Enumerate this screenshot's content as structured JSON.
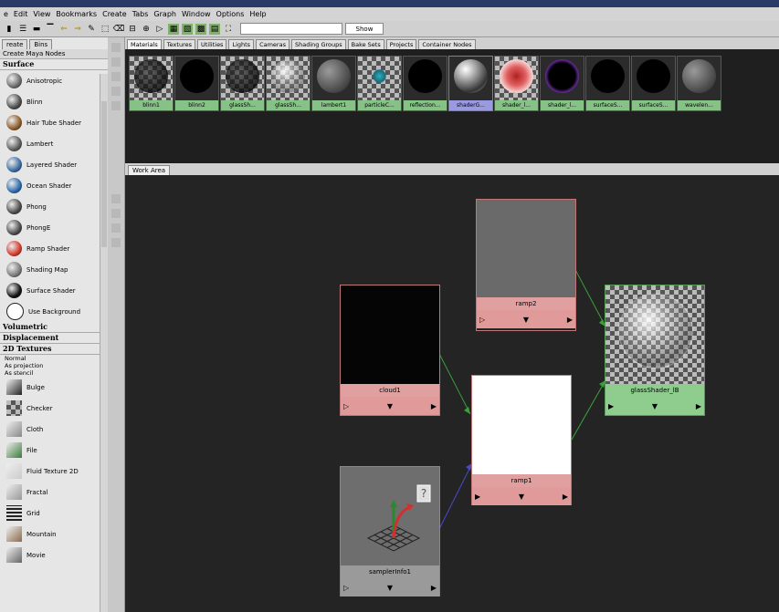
{
  "menubar": {
    "items": [
      "e",
      "Edit",
      "View",
      "Bookmarks",
      "Create",
      "Tabs",
      "Graph",
      "Window",
      "Options",
      "Help"
    ]
  },
  "toolbar": {
    "show_label": "Show",
    "search_value": ""
  },
  "left_panel": {
    "tabs": [
      "reate",
      "Bins"
    ],
    "create_label": "Create Maya Nodes",
    "categories": {
      "surface": "Surface",
      "volumetric": "Volumetric",
      "displacement": "Displacement",
      "textures_2d": "2D Textures"
    },
    "surface_items": [
      {
        "label": "Anisotropic",
        "color": "#6a6a6a"
      },
      {
        "label": "Blinn",
        "color": "#4a4a4a"
      },
      {
        "label": "Hair Tube Shader",
        "color": "#8a5a2a"
      },
      {
        "label": "Lambert",
        "color": "#5a5a5a"
      },
      {
        "label": "Layered Shader",
        "color": "#3a6aa0"
      },
      {
        "label": "Ocean Shader",
        "color": "#2a6aaa"
      },
      {
        "label": "Phong",
        "color": "#4a4a4a"
      },
      {
        "label": "PhongE",
        "color": "#4a4a4a"
      },
      {
        "label": "Ramp Shader",
        "color": "#d03a2a"
      },
      {
        "label": "Shading Map",
        "color": "#7a7a7a"
      },
      {
        "label": "Surface Shader",
        "color": "#111111"
      },
      {
        "label": "Use Background",
        "color": "#ffffff"
      }
    ],
    "texture_options": [
      "Normal",
      "As projection",
      "As stencil"
    ],
    "texture_items": [
      {
        "label": "Bulge",
        "color": "#222222"
      },
      {
        "label": "Checker",
        "color": "#000000"
      },
      {
        "label": "Cloth",
        "color": "#888888"
      },
      {
        "label": "File",
        "color": "#3a7a3a"
      },
      {
        "label": "Fluid Texture 2D",
        "color": "#cccccc"
      },
      {
        "label": "Fractal",
        "color": "#999999"
      },
      {
        "label": "Grid",
        "color": "#333333"
      },
      {
        "label": "Mountain",
        "color": "#8a6a4a"
      },
      {
        "label": "Movie",
        "color": "#666666"
      }
    ]
  },
  "hypershade": {
    "tabs": [
      "Materials",
      "Textures",
      "Utilities",
      "Lights",
      "Cameras",
      "Shading Groups",
      "Bake Sets",
      "Projects",
      "Container Nodes"
    ],
    "swatches": [
      {
        "label": "blinn1",
        "style": "checker-dark"
      },
      {
        "label": "blinn2",
        "style": "black"
      },
      {
        "label": "glassSh...",
        "style": "checker-dark"
      },
      {
        "label": "glassSh...",
        "style": "glass"
      },
      {
        "label": "lambert1",
        "style": "gray"
      },
      {
        "label": "particleC...",
        "style": "particle"
      },
      {
        "label": "reflection...",
        "style": "black"
      },
      {
        "label": "shaderG...",
        "style": "chrome"
      },
      {
        "label": "shader_l...",
        "style": "red"
      },
      {
        "label": "shader_l...",
        "style": "purple"
      },
      {
        "label": "surfaceS...",
        "style": "black"
      },
      {
        "label": "surfaceS...",
        "style": "black"
      },
      {
        "label": "wavelen...",
        "style": "gray"
      }
    ]
  },
  "work_area": {
    "tab_label": "Work Area",
    "nodes": {
      "ramp2": "ramp2",
      "cloud1": "cloud1",
      "ramp1": "ramp1",
      "glass": "glassShader_lB",
      "sampler": "samplerInfo1"
    }
  }
}
